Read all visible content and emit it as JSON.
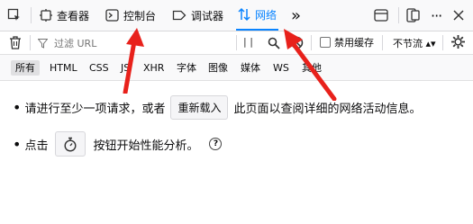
{
  "toolbar": {
    "tabs": [
      {
        "label": "查看器"
      },
      {
        "label": "控制台"
      },
      {
        "label": "调试器"
      },
      {
        "label": "网络"
      }
    ],
    "more_symbol": "»"
  },
  "filter": {
    "placeholder": "过滤 URL",
    "pause_symbol": "| |",
    "disable_cache_label": "禁用缓存",
    "throttle_value": "不节流 ▴▾"
  },
  "types": [
    "所有",
    "HTML",
    "CSS",
    "JS",
    "XHR",
    "字体",
    "图像",
    "媒体",
    "WS",
    "其他"
  ],
  "content": {
    "line1_prefix": "请进行至少一项请求，或者",
    "reload_button": "重新载入",
    "line1_suffix": "此页面以查阅详细的网络活动信息。",
    "line2_prefix": "点击",
    "line2_suffix": "按钮开始性能分析。",
    "help_symbol": "?"
  },
  "colors": {
    "accent": "#0a84ff",
    "annotation_arrow": "#e8211b"
  }
}
